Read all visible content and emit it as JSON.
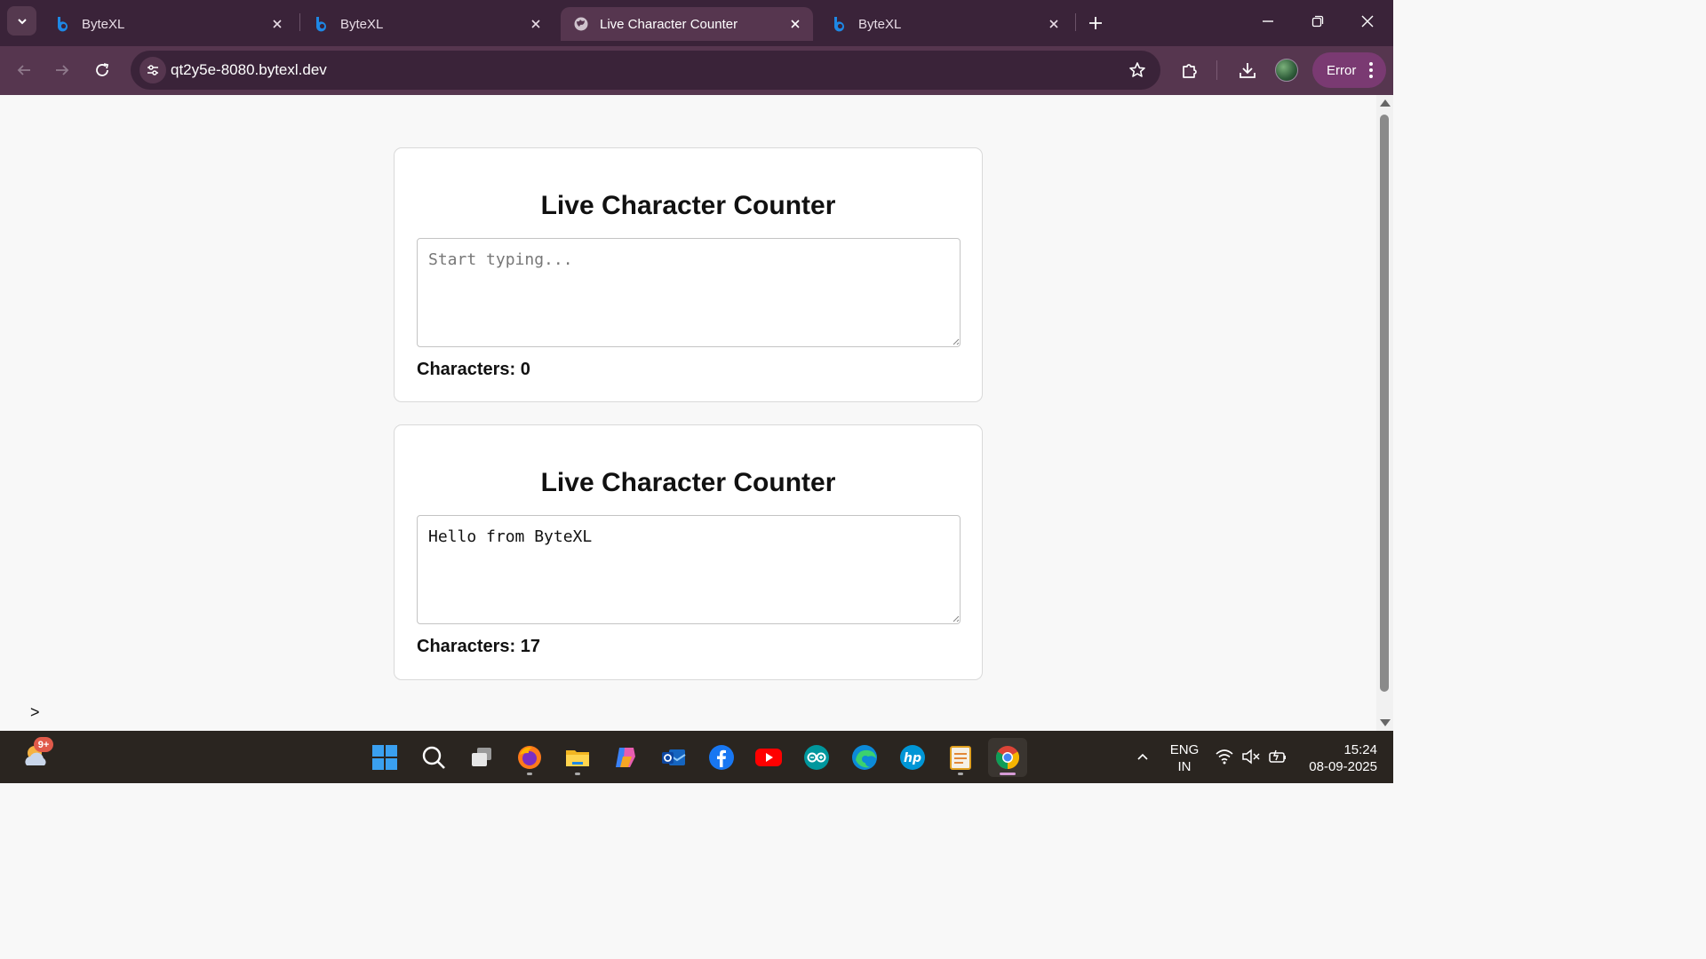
{
  "browser": {
    "tabs": [
      {
        "label": "ByteXL",
        "icon": "bytexl-b-icon",
        "active": false
      },
      {
        "label": "ByteXL",
        "icon": "bytexl-b-icon",
        "active": false
      },
      {
        "label": "Live Character Counter",
        "icon": "globe-icon",
        "active": true
      },
      {
        "label": "ByteXL",
        "icon": "bytexl-b-icon",
        "active": false
      }
    ],
    "url": "qt2y5e-8080.bytexl.dev",
    "profile_status": "Error"
  },
  "page": {
    "counters": [
      {
        "heading": "Live Character Counter",
        "placeholder": "Start typing...",
        "value": "",
        "count_label": "Characters: 0"
      },
      {
        "heading": "Live Character Counter",
        "placeholder": "Start typing...",
        "value": "Hello from ByteXL",
        "count_label": "Characters: 17"
      }
    ],
    "console_caret": ">"
  },
  "taskbar": {
    "notification_badge": "9+",
    "apps": [
      "start-icon",
      "search-icon",
      "task-view-icon",
      "firefox-icon",
      "file-explorer-icon",
      "copilot-icon",
      "outlook-icon",
      "facebook-icon",
      "youtube-icon",
      "arduino-icon",
      "edge-icon",
      "hp-icon",
      "notepad-icon",
      "chrome-icon"
    ],
    "language_line1": "ENG",
    "language_line2": "IN",
    "time": "15:24",
    "date": "08-09-2025"
  },
  "colors": {
    "tabstrip": "#3a2339",
    "toolbar": "#56364f",
    "accent_error": "#7a3a72",
    "bytexl_blue": "#1e88e5",
    "taskbar": "#2a2520"
  }
}
